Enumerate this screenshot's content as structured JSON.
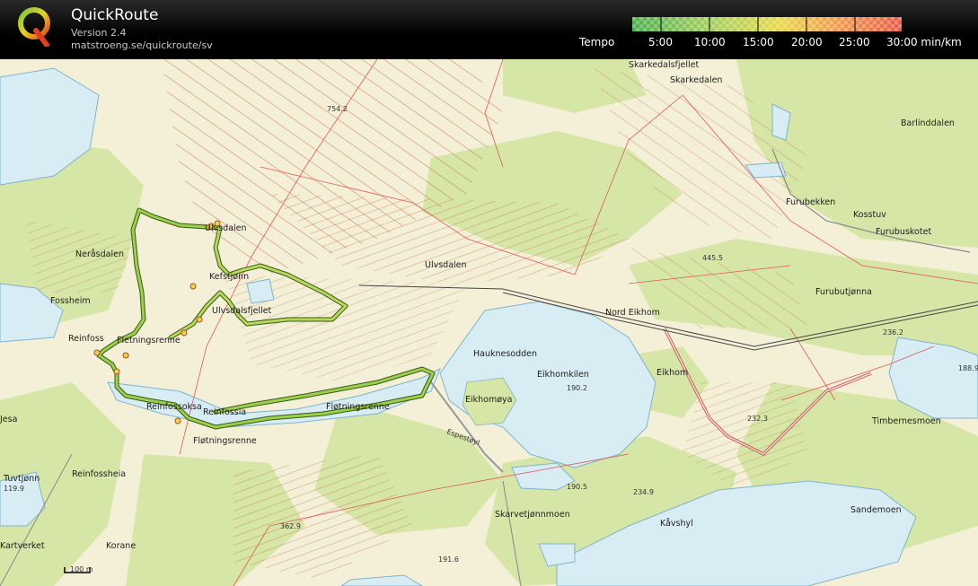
{
  "header": {
    "title": "QuickRoute",
    "version": "Version 2.4",
    "url": "matstroeng.se/quickroute/sv",
    "tempo_label": "Tempo",
    "tempo_ticks": [
      "5:00",
      "10:00",
      "15:00",
      "20:00",
      "25:00",
      "30:00 min/km"
    ],
    "scale_colors": [
      "#4fb04f",
      "#a8d060",
      "#e8d84a",
      "#f0a050",
      "#e8604a"
    ]
  },
  "map": {
    "place_names": {
      "skarkedalsfjellet": "Skarkedalsfjellet",
      "skarkedalen": "Skarkedalen",
      "barlinddalen": "Barlinddalen",
      "furubekken": "Furubekken",
      "kosstuv": "Kosstuv",
      "furubuskotet": "Furubuskotet",
      "furubutjonna": "Furubutjønna",
      "ulvsdalen_west": "Ulvsdalen",
      "ulvsdalen_east": "Ulvsdalen",
      "nerasdalen": "Neråsdalen",
      "kefstjonn": "Kefstjønn",
      "ulvsdalsfjellet": "Ulvsdalsfjellet",
      "fossheim": "Fossheim",
      "reinfoss": "Reinfoss",
      "fletningsrenne_north": "Fletningsrenne",
      "nord_eikhom": "Nord Eikhom",
      "hauknesodden": "Hauknesodden",
      "eikhomkilen": "Eikhomkilen",
      "eikhom": "Eikhom",
      "eikhommoya": "Eikhomøya",
      "reinfossoksa": "Reinfossoksa",
      "reinfossia": "Reinfossia",
      "flotningsrenne_east": "Fløtningsrenne",
      "flotningsrenne_south": "Fløtningsrenne",
      "timbernesmoen": "Timbernesmoen",
      "jesa": "Jesa",
      "reinfossheia": "Reinfossheia",
      "tuvtjonn": "Tuvtjønn",
      "skarvetjonnmoen": "Skarvetjønnmoen",
      "sandemoen": "Sandemoen",
      "kavshyl": "Kåvshyl",
      "korane": "Korane",
      "kartverket": "Kartverket",
      "espestoyl": "Espestøyl"
    },
    "elevations": {
      "e754": "754.2",
      "e445": "445.5",
      "e236": "236.2",
      "e188": "188.9",
      "e190a": "190.2",
      "e232": "232.3",
      "e190b": "190.5",
      "e234": "234.9",
      "e362": "362.9",
      "e191": "191.6",
      "e119": "119.9"
    },
    "scale_bar": "100 m"
  }
}
